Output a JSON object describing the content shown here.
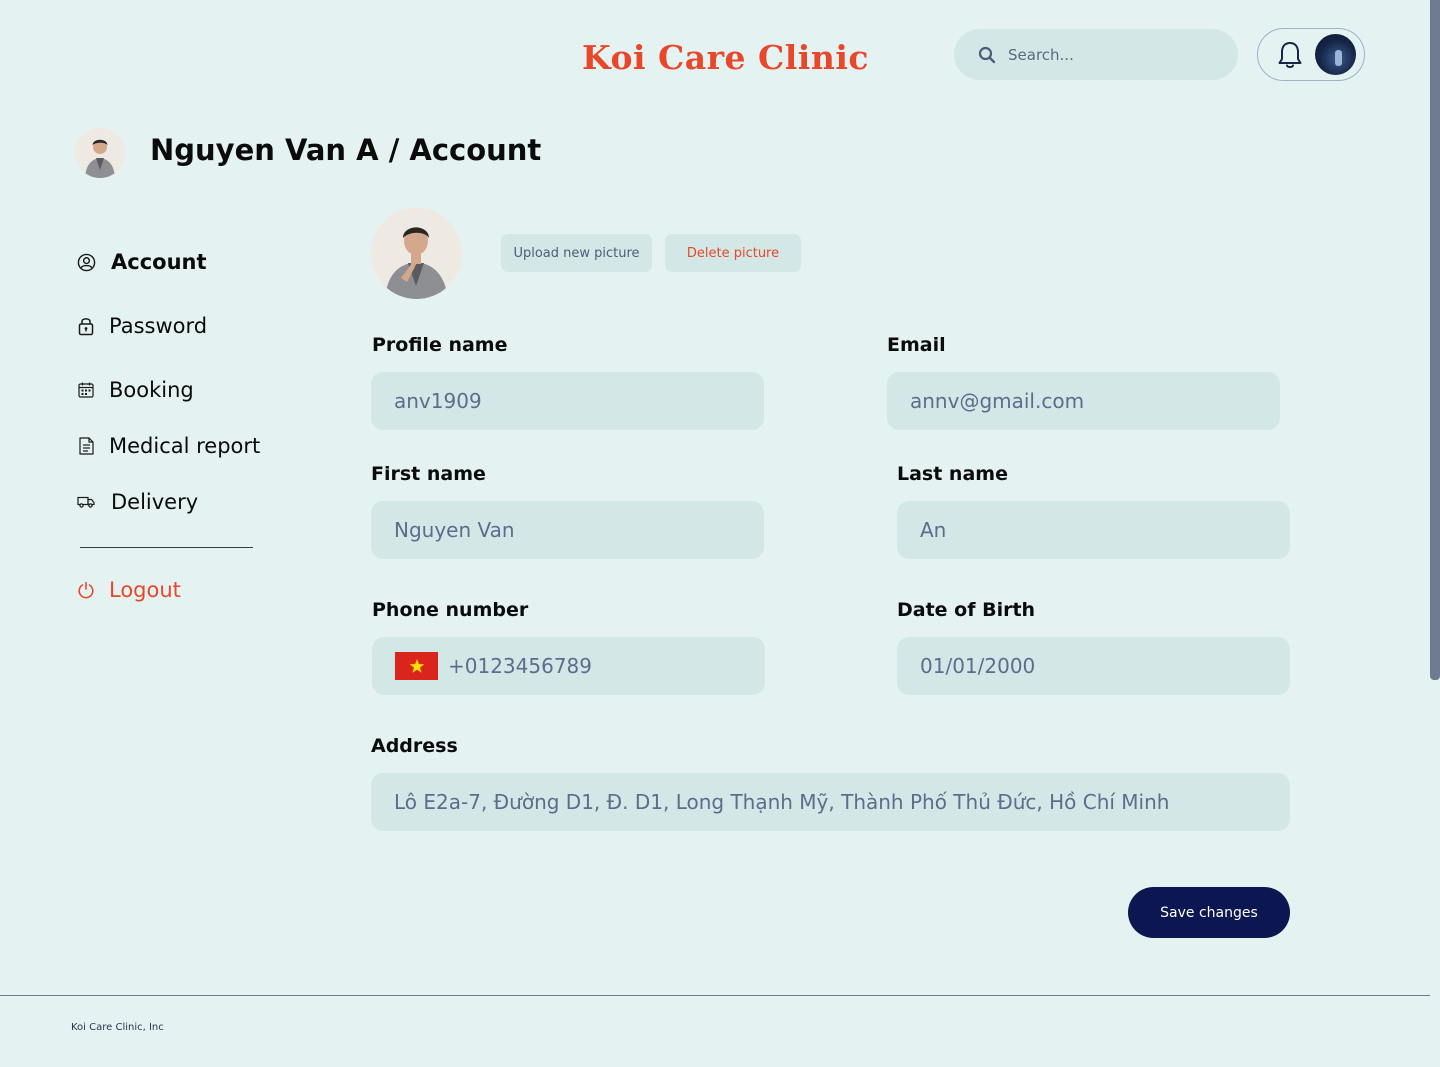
{
  "header": {
    "brand": "Koi Care Clinic",
    "search_placeholder": "Search...",
    "colors": {
      "brand": "#e8472a",
      "accent_dark": "#0c1650",
      "background": "#e4f3f2",
      "field_bg": "#d3e8e6"
    }
  },
  "page": {
    "title": "Nguyen Van A / Account"
  },
  "sidebar": {
    "items": [
      {
        "label": "Account",
        "icon": "user-circle-icon",
        "active": true
      },
      {
        "label": "Password",
        "icon": "lock-icon"
      },
      {
        "label": "Booking",
        "icon": "calendar-icon"
      },
      {
        "label": "Medical report",
        "icon": "document-icon"
      },
      {
        "label": "Delivery",
        "icon": "truck-icon"
      }
    ],
    "logout": {
      "label": "Logout",
      "icon": "power-icon"
    }
  },
  "profile_picture": {
    "upload_label": "Upload new picture",
    "delete_label": "Delete picture"
  },
  "form": {
    "profile_name": {
      "label": "Profile name",
      "value": "anv1909"
    },
    "email": {
      "label": "Email",
      "value": "annv@gmail.com"
    },
    "first_name": {
      "label": "First name",
      "value": "Nguyen Van"
    },
    "last_name": {
      "label": "Last name",
      "value": "An"
    },
    "phone": {
      "label": "Phone number",
      "value": "+0123456789",
      "flag": "vietnam-flag-icon"
    },
    "dob": {
      "label": "Date of Birth",
      "value": "01/01/2000"
    },
    "address": {
      "label": "Address",
      "value": "Lô E2a-7, Đường D1, Đ. D1, Long Thạnh Mỹ, Thành Phố Thủ Đức, Hồ Chí Minh"
    },
    "save_label": "Save changes"
  },
  "footer": {
    "text": "Koi Care Clinic, Inc"
  }
}
